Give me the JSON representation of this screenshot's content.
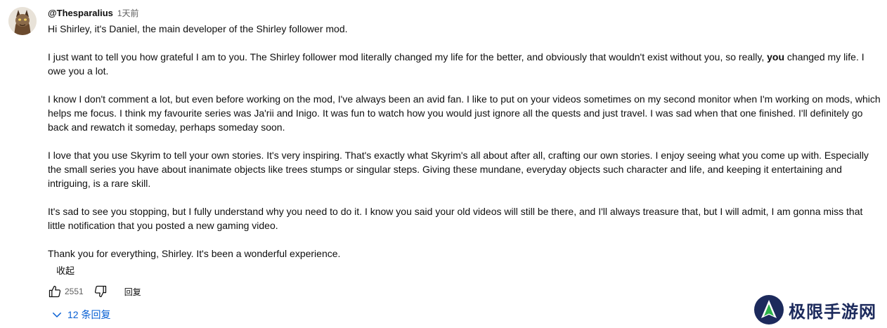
{
  "comment": {
    "author": "@Thesparalius",
    "timestamp": "1天前",
    "paragraphs": [
      [
        "Hi Shirley, it's Daniel, the main developer of the Shirley follower mod."
      ],
      [
        "I just want to tell you how grateful I am to you. The Shirley follower mod literally changed my life for the better, and obviously that wouldn't exist without you, so really, ",
        "you",
        " changed my life. I owe you a lot."
      ],
      [
        "I know I don't comment a lot, but even before working on the mod, I've always been an avid fan. I like to put on your videos sometimes on my second monitor when I'm working on mods, which helps me focus. I think my favourite series was Ja'rii and Inigo. It was fun to watch how you would just ignore all the quests and just travel. I was sad when that one finished. I'll definitely go back and rewatch it someday, perhaps someday soon."
      ],
      [
        "I love that you use Skyrim to tell your own stories. It's very inspiring. That's exactly what Skyrim's all about after all, crafting our own stories. I enjoy seeing what you come up with. Especially the small series you have about inanimate objects like trees stumps or singular steps. Giving these mundane, everyday objects such character and life, and keeping it entertaining and intriguing, is a rare skill."
      ],
      [
        "It's sad to see you stopping, but I fully understand why you need to do it. I know you said your old videos will still be there, and I'll always treasure that, but I will admit, I am gonna miss that little notification that you posted a new gaming video."
      ],
      [
        "Thank you for everything, Shirley. It's been a wonderful experience."
      ]
    ],
    "collapse_label": "收起",
    "like_count": "2551",
    "reply_label": "回复",
    "replies_label": "12 条回复"
  },
  "icons": {
    "like": "thumbs-up-icon",
    "dislike": "thumbs-down-icon",
    "expand": "chevron-down-icon"
  },
  "watermark": {
    "text": "极限手游网"
  },
  "colors": {
    "text": "#0f0f0f",
    "secondary_text": "#606060",
    "link_blue": "#065fd4",
    "watermark_navy": "#1c2a5c",
    "watermark_green": "#2db34a"
  }
}
